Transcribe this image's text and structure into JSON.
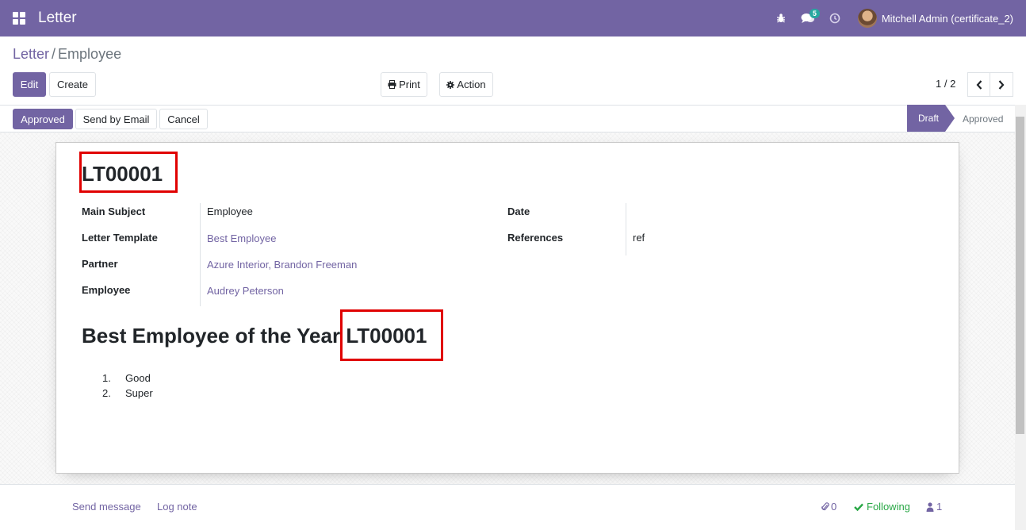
{
  "navbar": {
    "app_name": "Letter",
    "messages_badge": "5",
    "user_name": "Mitchell Admin (certificate_2)"
  },
  "breadcrumb": {
    "parent": "Letter",
    "current": "Employee"
  },
  "toolbar": {
    "edit_label": "Edit",
    "create_label": "Create",
    "print_label": "Print",
    "action_label": "Action",
    "pager_value": "1 / 2"
  },
  "statusbar": {
    "approved_label": "Approved",
    "send_email_label": "Send by Email",
    "cancel_label": "Cancel",
    "stages": [
      "Draft",
      "Approved"
    ],
    "current_stage": "Draft"
  },
  "form": {
    "reference": "LT00001",
    "fields_left": [
      {
        "label": "Main Subject",
        "value": "Employee"
      },
      {
        "label": "Letter Template",
        "value": "Best Employee"
      },
      {
        "label": "Partner",
        "value": "Azure Interior, Brandon Freeman"
      },
      {
        "label": "Employee",
        "value": "Audrey Peterson"
      }
    ],
    "fields_right": [
      {
        "label": "Date",
        "value": ""
      },
      {
        "label": "References",
        "value": "ref"
      }
    ],
    "body_title_prefix": "Best Employee of the Year",
    "body_title_ref": "LT00001",
    "body_list": [
      {
        "num": "1.",
        "text": "Good"
      },
      {
        "num": "2.",
        "text": "Super"
      }
    ]
  },
  "chatter": {
    "send_message_label": "Send message",
    "log_note_label": "Log note",
    "attachments_count": "0",
    "following_label": "Following",
    "followers_count": "1"
  },
  "colors": {
    "brand": "#7264a3",
    "highlight": "#e00000",
    "following": "#28a745"
  }
}
